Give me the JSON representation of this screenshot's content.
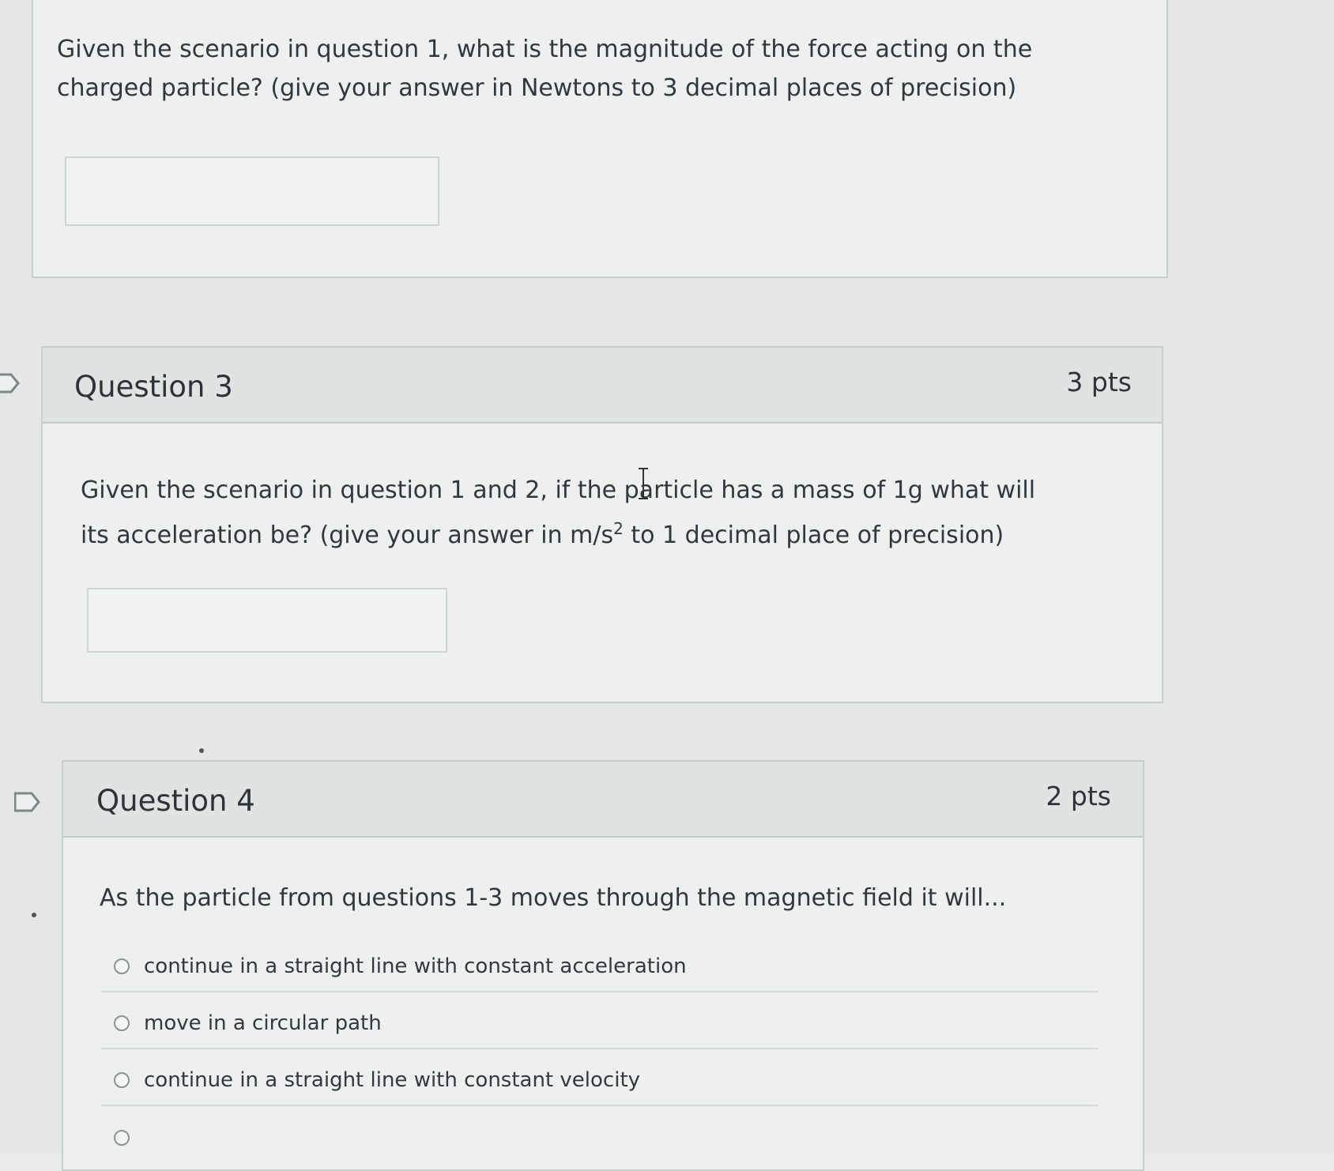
{
  "question2": {
    "text": "Given the scenario in question 1, what is the magnitude of the force acting on the charged particle? (give your answer in Newtons to 3 decimal places of precision)",
    "answer_value": "",
    "answer_placeholder": ""
  },
  "question3": {
    "title": "Question 3",
    "points": "3 pts",
    "text_before_sup": "Given the scenario in question 1 and 2, if the particle has a mass of 1g what will its acceleration be? (give your answer in m/s",
    "superscript": "2",
    "text_after_sup": " to 1 decimal place of precision)",
    "answer_value": "",
    "answer_placeholder": ""
  },
  "question4": {
    "title": "Question 4",
    "points": "2 pts",
    "text": "As the particle from questions 1-3 moves through the magnetic field it will...",
    "options": [
      {
        "label": "continue in a straight line with constant acceleration"
      },
      {
        "label": "move in a circular path"
      },
      {
        "label": "continue in a straight line with constant velocity"
      }
    ]
  },
  "icons": {
    "flag": "flag-outline-icon",
    "text_cursor": "i-beam-cursor-icon"
  }
}
